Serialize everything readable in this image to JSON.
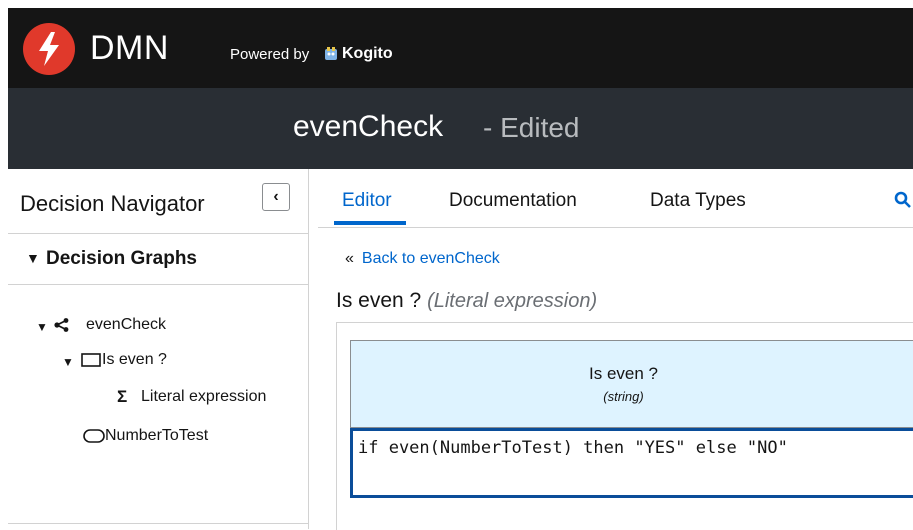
{
  "brand": {
    "logo_text": "DMN",
    "powered_by": "Powered by",
    "kogito": "Kogito",
    "accent_color": "#e0392b"
  },
  "title": {
    "name": "evenCheck",
    "status": "- Edited"
  },
  "navigator": {
    "title": "Decision Navigator",
    "collapse_icon": "chevron-left-icon",
    "section_title": "Decision Graphs",
    "tree": {
      "root": "evenCheck",
      "decision": "Is even ?",
      "expression": "Literal expression",
      "input": "NumberToTest"
    }
  },
  "tabs": [
    {
      "label": "Editor",
      "active": true
    },
    {
      "label": "Documentation",
      "active": false
    },
    {
      "label": "Data Types",
      "active": false
    }
  ],
  "editor": {
    "back_link": "Back to evenCheck",
    "back_icon": "«",
    "expression_name": "Is even ?",
    "expression_kind": "(Literal expression)",
    "header_name": "Is even ?",
    "header_type": "(string)",
    "expression_text": "if even(NumberToTest) then \"YES\" else \"NO\""
  },
  "colors": {
    "link": "#0066cc",
    "header_bg": "#def3ff",
    "selected_border": "#0a4d99"
  }
}
